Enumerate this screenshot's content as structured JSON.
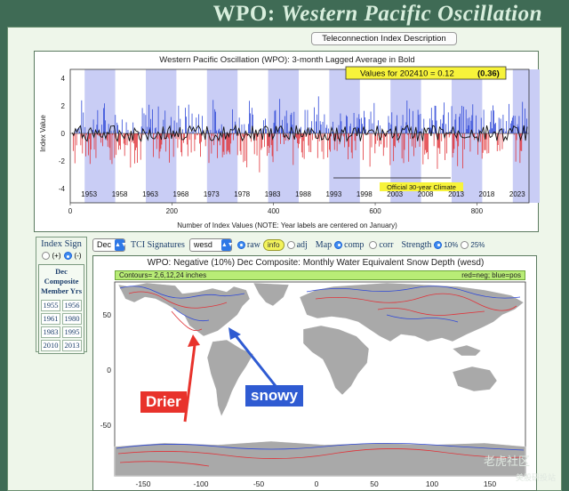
{
  "header": {
    "title_a": "WPO:",
    "title_b": "Western Pacific Oscillation"
  },
  "tci_button": "Teleconnection Index Description",
  "timeseries": {
    "title": "Western Pacific Oscillation (WPO): 3-month Lagged Average in Bold",
    "value_box": "Values for 202410 = 0.12",
    "value_bold": "(0.36)",
    "ylabel": "Index Value",
    "xlabel": "Number of Index Values (NOTE: Year labels are centered on January)",
    "climate_label": "Official 30-year Climate",
    "yticks": [
      "4",
      "2",
      "0",
      "-2",
      "-4"
    ],
    "xticks": [
      "0",
      "200",
      "400",
      "600",
      "800"
    ],
    "years": [
      "1953",
      "1958",
      "1963",
      "1968",
      "1973",
      "1978",
      "1983",
      "1988",
      "1993",
      "1998",
      "2003",
      "2008",
      "2013",
      "2018",
      "2023"
    ]
  },
  "index_sign": {
    "title": "Index Sign",
    "pos_label": "(+)",
    "neg_label": "(-)",
    "yrs_head": [
      "Dec",
      "Composite",
      "Member Yrs"
    ],
    "years": [
      "1955",
      "1956",
      "1961",
      "1980",
      "1983",
      "1995",
      "2010",
      "2013"
    ]
  },
  "controls": {
    "month": "Dec",
    "tci_label": "TCI Signatures",
    "variable": "wesd",
    "raw": "raw",
    "info": "info",
    "adj": "adj",
    "map_label": "Map",
    "comp": "comp",
    "corr": "corr",
    "strength_label": "Strength",
    "s10": "10%",
    "s25": "25%"
  },
  "map": {
    "title": "WPO: Negative (10%) Dec Composite: Monthly Water Equivalent Snow Depth (wesd)",
    "contours": "Contours= 2,6,12,24 inches",
    "legend": "red=neg; blue=pos",
    "yticks": [
      "50",
      "0",
      "-50"
    ],
    "xticks": [
      "-150",
      "-100",
      "-50",
      "0",
      "50",
      "100",
      "150"
    ]
  },
  "callouts": {
    "drier": "Drier",
    "snowy": "snowy"
  },
  "watermark": "老虎社区",
  "watermark2": "美股研投站",
  "colors": {
    "band": "#c9cdf5",
    "neg": "#e0343a",
    "pos": "#2f49d8",
    "bg": "#3f6b55"
  }
}
